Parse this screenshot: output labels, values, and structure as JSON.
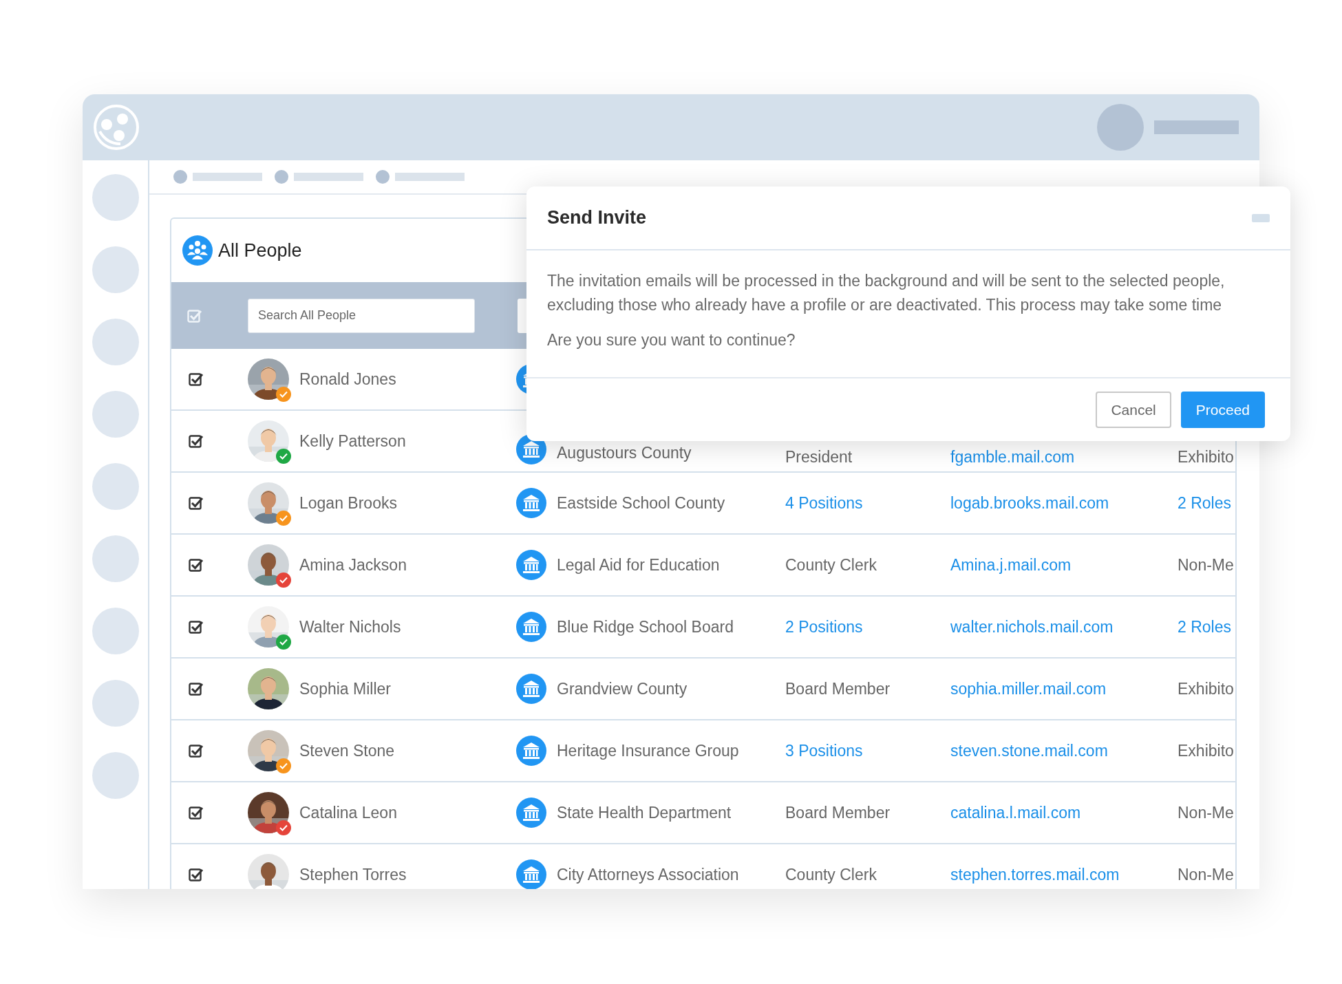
{
  "people_list": {
    "title": "All People",
    "select_all": {
      "checked": true
    },
    "search": {
      "placeholder": "Search All People"
    },
    "rows": [
      {
        "checked": true,
        "name": "Ronald Jones",
        "color": "#f7941d"
      },
      {
        "checked": true,
        "name": "Kelly Patterson",
        "color": "#1fa845",
        "organization": "Augustours County",
        "position": {
          "text": "President",
          "kind": "text"
        },
        "email": "fgamble.mail.com",
        "role": {
          "text": "Exhibito",
          "kind": "text"
        }
      },
      {
        "checked": true,
        "name": "Logan Brooks",
        "color": "#f7941d",
        "organization": "Eastside School County",
        "position": {
          "text": "4 Positions",
          "kind": "link"
        },
        "email": "logab.brooks.mail.com",
        "role": {
          "text": "2 Roles",
          "kind": "link"
        }
      },
      {
        "checked": true,
        "name": "Amina Jackson",
        "color": "#e5443a",
        "organization": "Legal Aid for Education",
        "position": {
          "text": "County Clerk",
          "kind": "text"
        },
        "email": "Amina.j.mail.com",
        "role": {
          "text": "Non-Me",
          "kind": "text"
        }
      },
      {
        "checked": true,
        "name": "Walter Nichols",
        "color": "#1fa845",
        "organization": "Blue Ridge School Board",
        "position": {
          "text": "2 Positions",
          "kind": "link"
        },
        "email": "walter.nichols.mail.com",
        "role": {
          "text": "2 Roles",
          "kind": "link"
        }
      },
      {
        "checked": true,
        "name": "Sophia Miller",
        "organization": "Grandview County",
        "position": {
          "text": "Board Member",
          "kind": "text"
        },
        "email": "sophia.miller.mail.com",
        "role": {
          "text": "Exhibito",
          "kind": "text"
        }
      },
      {
        "checked": true,
        "name": "Steven Stone",
        "color": "#f7941d",
        "organization": "Heritage Insurance Group",
        "position": {
          "text": "3 Positions",
          "kind": "link"
        },
        "email": "steven.stone.mail.com",
        "role": {
          "text": "Exhibito",
          "kind": "text"
        }
      },
      {
        "checked": true,
        "name": "Catalina Leon",
        "color": "#e5443a",
        "organization": "State Health Department",
        "position": {
          "text": "Board Member",
          "kind": "text"
        },
        "email": "catalina.l.mail.com",
        "role": {
          "text": "Non-Me",
          "kind": "text"
        }
      },
      {
        "checked": true,
        "name": "Stephen Torres",
        "organization": "City Attorneys Association",
        "position": {
          "text": "County Clerk",
          "kind": "text"
        },
        "email": "stephen.torres.mail.com",
        "role": {
          "text": "Non-Me",
          "kind": "text"
        }
      }
    ]
  },
  "dialog": {
    "title": "Send Invite",
    "message": "The invitation emails will be processed in the background and will be sent to the selected people, excluding those who already have a profile or are deactivated. This process may take some time",
    "question": "Are you sure you want to continue?",
    "buttons": [
      {
        "label": "Cancel",
        "kind": "secondary"
      },
      {
        "label": "Proceed",
        "kind": "primary"
      }
    ]
  }
}
